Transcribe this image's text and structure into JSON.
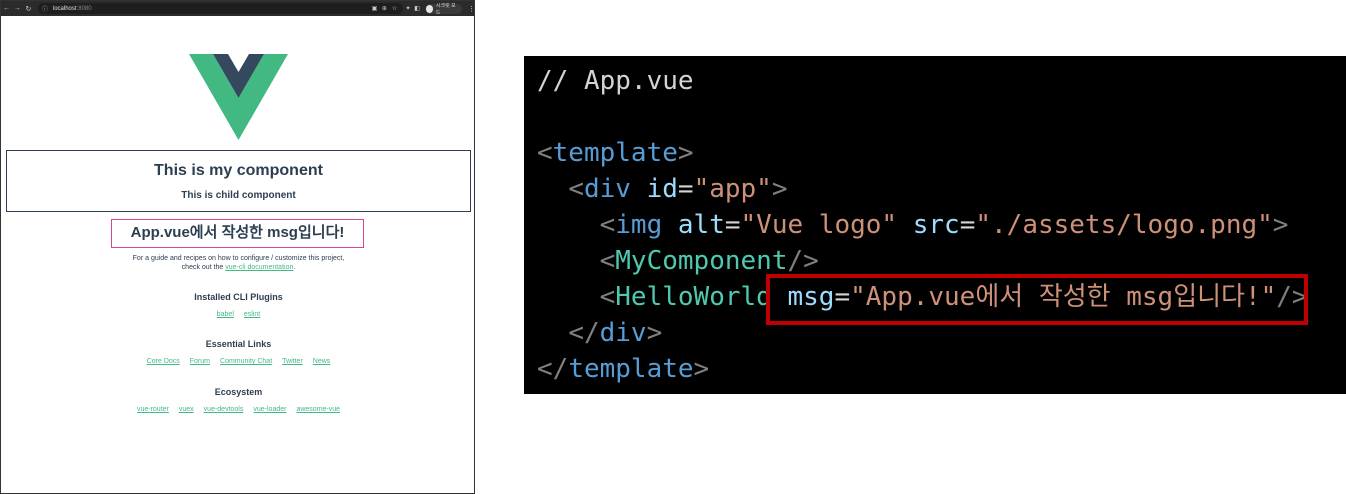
{
  "browser": {
    "url_host": "localhost",
    "url_port": ":8080",
    "profile_name": "시크릿 모드"
  },
  "page": {
    "component_title": "This is my component",
    "component_subtitle": "This is child component",
    "hello_msg": "App.vue에서 작성한 msg입니다!",
    "intro_line1": "For a guide and recipes on how to configure / customize this project,",
    "intro_prefix": "check out the ",
    "intro_link": "vue-cli documentation",
    "intro_suffix": ".",
    "sections": [
      {
        "title": "Installed CLI Plugins",
        "links": [
          "babel",
          "eslint"
        ]
      },
      {
        "title": "Essential Links",
        "links": [
          "Core Docs",
          "Forum",
          "Community Chat",
          "Twitter",
          "News"
        ]
      },
      {
        "title": "Ecosystem",
        "links": [
          "vue-router",
          "vuex",
          "vue-devtools",
          "vue-loader",
          "awesome-vue"
        ]
      }
    ]
  },
  "code": {
    "comment": "// App.vue",
    "template_tag": "template",
    "div_tag": "div",
    "id_attr": "id",
    "id_val": "\"app\"",
    "img_tag": "img",
    "alt_attr": "alt",
    "alt_val": "\"Vue logo\"",
    "src_attr": "src",
    "src_val": "\"./assets/logo.png\"",
    "my_component": "MyComponent",
    "hello_world": "HelloWorld",
    "msg_attr": "msg",
    "msg_val": "\"App.vue에서 작성한 msg입니다!\""
  },
  "colors": {
    "vue_green": "#42b983",
    "vue_dark": "#35495e",
    "highlight_red": "#c00000",
    "hello_border": "#d9468f"
  }
}
